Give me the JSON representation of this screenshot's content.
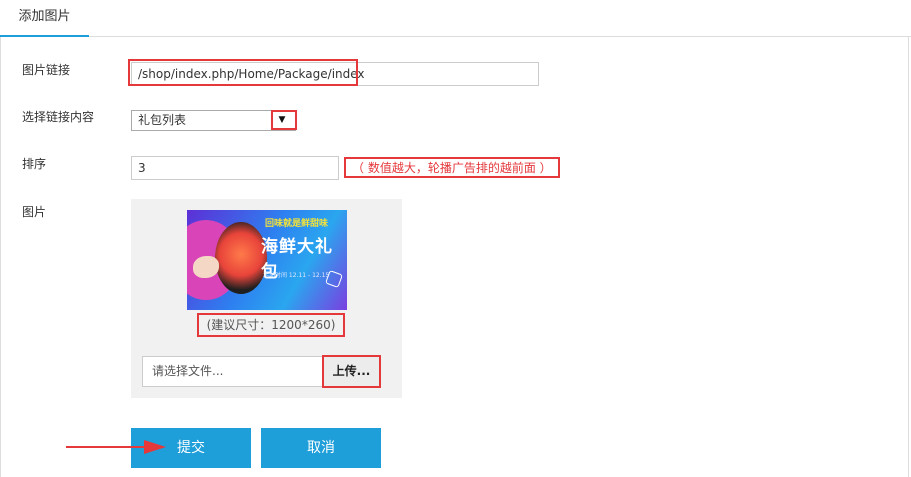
{
  "tabs": [
    {
      "label": "添加图片"
    }
  ],
  "form": {
    "link": {
      "label": "图片链接",
      "value": "/shop/index.php/Home/Package/index"
    },
    "link_content": {
      "label": "选择链接内容",
      "selected": "礼包列表",
      "arrow": "▼"
    },
    "sort": {
      "label": "排序",
      "value": "3",
      "hint": "（ 数值越大，轮播广告排的越前面 ）"
    },
    "image": {
      "label": "图片",
      "size_hint": "(建议尺寸：1200*260)",
      "file_placeholder": "请选择文件...",
      "upload_label": "上传..."
    }
  },
  "banner": {
    "small_title": "回味就是鲜甜味",
    "big_title": "海鲜大礼包",
    "sub": "活动时间 12.11 - 12.15"
  },
  "actions": {
    "submit_label": "提交",
    "cancel_label": "取消"
  },
  "colors": {
    "accent": "#1e9fd9",
    "annotation_red": "#e5383b"
  }
}
